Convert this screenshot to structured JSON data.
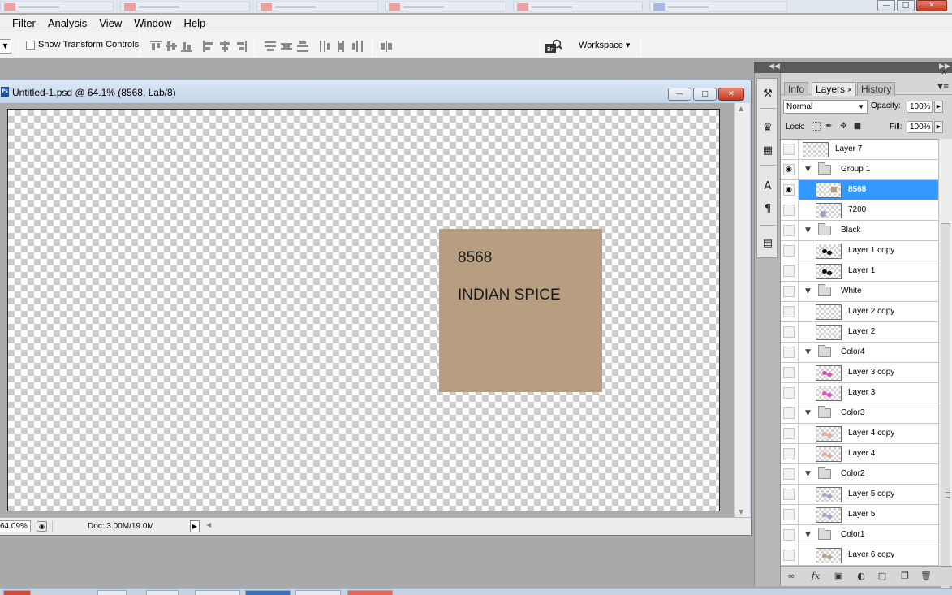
{
  "menubar": {
    "items": [
      "Filter",
      "Analysis",
      "View",
      "Window",
      "Help"
    ]
  },
  "optionsbar": {
    "show_transform_label": "Show Transform Controls",
    "show_transform_checked": false,
    "workspace_label": "Workspace ▾"
  },
  "document": {
    "title": "Untitled-1.psd @ 64.1% (8568, Lab/8)",
    "ps_badge": "Ps",
    "swatch_color": "#b89e80",
    "swatch_code": "8568",
    "swatch_name": "INDIAN SPICE",
    "zoom": "64.09%",
    "doc_size": "Doc: 3.00M/19.0M"
  },
  "panel": {
    "tabs": [
      {
        "label": "Info",
        "active": false
      },
      {
        "label": "Layers",
        "active": true,
        "close": "×"
      },
      {
        "label": "History",
        "active": false
      }
    ],
    "blend_mode": "Normal",
    "opacity_label": "Opacity:",
    "opacity_value": "100%",
    "lock_label": "Lock:",
    "fill_label": "Fill:",
    "fill_value": "100%"
  },
  "layers": [
    {
      "name": "Layer 7",
      "kind": "layer",
      "indent": 0,
      "visible": false,
      "selected": false,
      "dot_color": ""
    },
    {
      "name": "Group 1",
      "kind": "group",
      "visible": true,
      "selected": false
    },
    {
      "name": "8568",
      "kind": "layer",
      "indent": 1,
      "visible": true,
      "selected": true,
      "dot_color": "#b89e80"
    },
    {
      "name": "7200",
      "kind": "layer",
      "indent": 1,
      "visible": false,
      "selected": false,
      "dot_color": "#a59bc6"
    },
    {
      "name": "Black",
      "kind": "group",
      "visible": false,
      "selected": false
    },
    {
      "name": "Layer 1 copy",
      "kind": "layer",
      "indent": 1,
      "visible": false,
      "selected": false,
      "dot_color": "#111111"
    },
    {
      "name": "Layer 1",
      "kind": "layer",
      "indent": 1,
      "visible": false,
      "selected": false,
      "dot_color": "#111111"
    },
    {
      "name": "White",
      "kind": "group",
      "visible": false,
      "selected": false
    },
    {
      "name": "Layer 2 copy",
      "kind": "layer",
      "indent": 1,
      "visible": false,
      "selected": false,
      "dot_color": ""
    },
    {
      "name": "Layer 2",
      "kind": "layer",
      "indent": 1,
      "visible": false,
      "selected": false,
      "dot_color": ""
    },
    {
      "name": "Color4",
      "kind": "group",
      "visible": false,
      "selected": false
    },
    {
      "name": "Layer 3 copy",
      "kind": "layer",
      "indent": 1,
      "visible": false,
      "selected": false,
      "dot_color": "#e04fb8"
    },
    {
      "name": "Layer 3",
      "kind": "layer",
      "indent": 1,
      "visible": false,
      "selected": false,
      "dot_color": "#e04fb8"
    },
    {
      "name": "Color3",
      "kind": "group",
      "visible": false,
      "selected": false
    },
    {
      "name": "Layer 4 copy",
      "kind": "layer",
      "indent": 1,
      "visible": false,
      "selected": false,
      "dot_color": "#e8a99a"
    },
    {
      "name": "Layer 4",
      "kind": "layer",
      "indent": 1,
      "visible": false,
      "selected": false,
      "dot_color": "#e8a99a"
    },
    {
      "name": "Color2",
      "kind": "group",
      "visible": false,
      "selected": false
    },
    {
      "name": "Layer 5 copy",
      "kind": "layer",
      "indent": 1,
      "visible": false,
      "selected": false,
      "dot_color": "#a8a0c8"
    },
    {
      "name": "Layer 5",
      "kind": "layer",
      "indent": 1,
      "visible": false,
      "selected": false,
      "dot_color": "#a8a0c8"
    },
    {
      "name": "Color1",
      "kind": "group",
      "visible": false,
      "selected": false
    },
    {
      "name": "Layer 6 copy",
      "kind": "layer",
      "indent": 1,
      "visible": false,
      "selected": false,
      "dot_color": "#b7a08a"
    }
  ]
}
